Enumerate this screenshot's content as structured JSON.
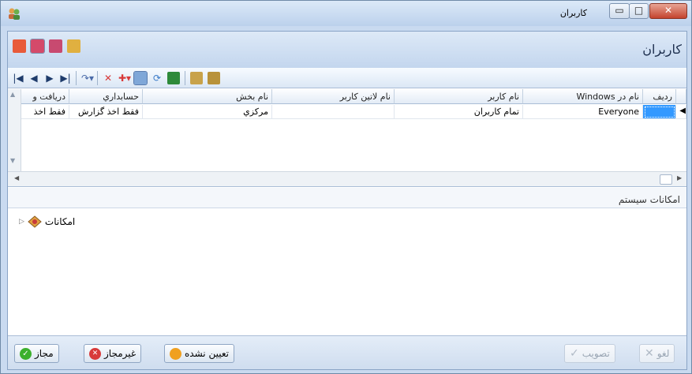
{
  "window": {
    "title": "كاربران"
  },
  "page": {
    "heading": "كاربران"
  },
  "grid": {
    "headers": [
      "رديف",
      "نام در Windows",
      "نام كاربر",
      "نام لاتين كاربر",
      "نام بخش",
      "حسابداري",
      "دريافت و"
    ],
    "row": {
      "radif": "",
      "windows_name": "Everyone",
      "user_name": "تمام كاربران",
      "latin_name": "",
      "section": "مركزي",
      "accounting": "فقط اخذ گزارش",
      "receive": "فقط اخذ"
    }
  },
  "section": {
    "label": "امكانات سيستم"
  },
  "tree": {
    "root_label": "امكانات"
  },
  "buttons": {
    "allowed": "مجاز",
    "not_allowed": "غيرمجاز",
    "unassigned": "تعيين نشده",
    "approve": "تصويب",
    "cancel": "لغو"
  },
  "colors": {
    "allowed": "#3cb02d",
    "not_allowed": "#d83a3a",
    "unassigned": "#f0a020",
    "accent": "#3399ff"
  }
}
